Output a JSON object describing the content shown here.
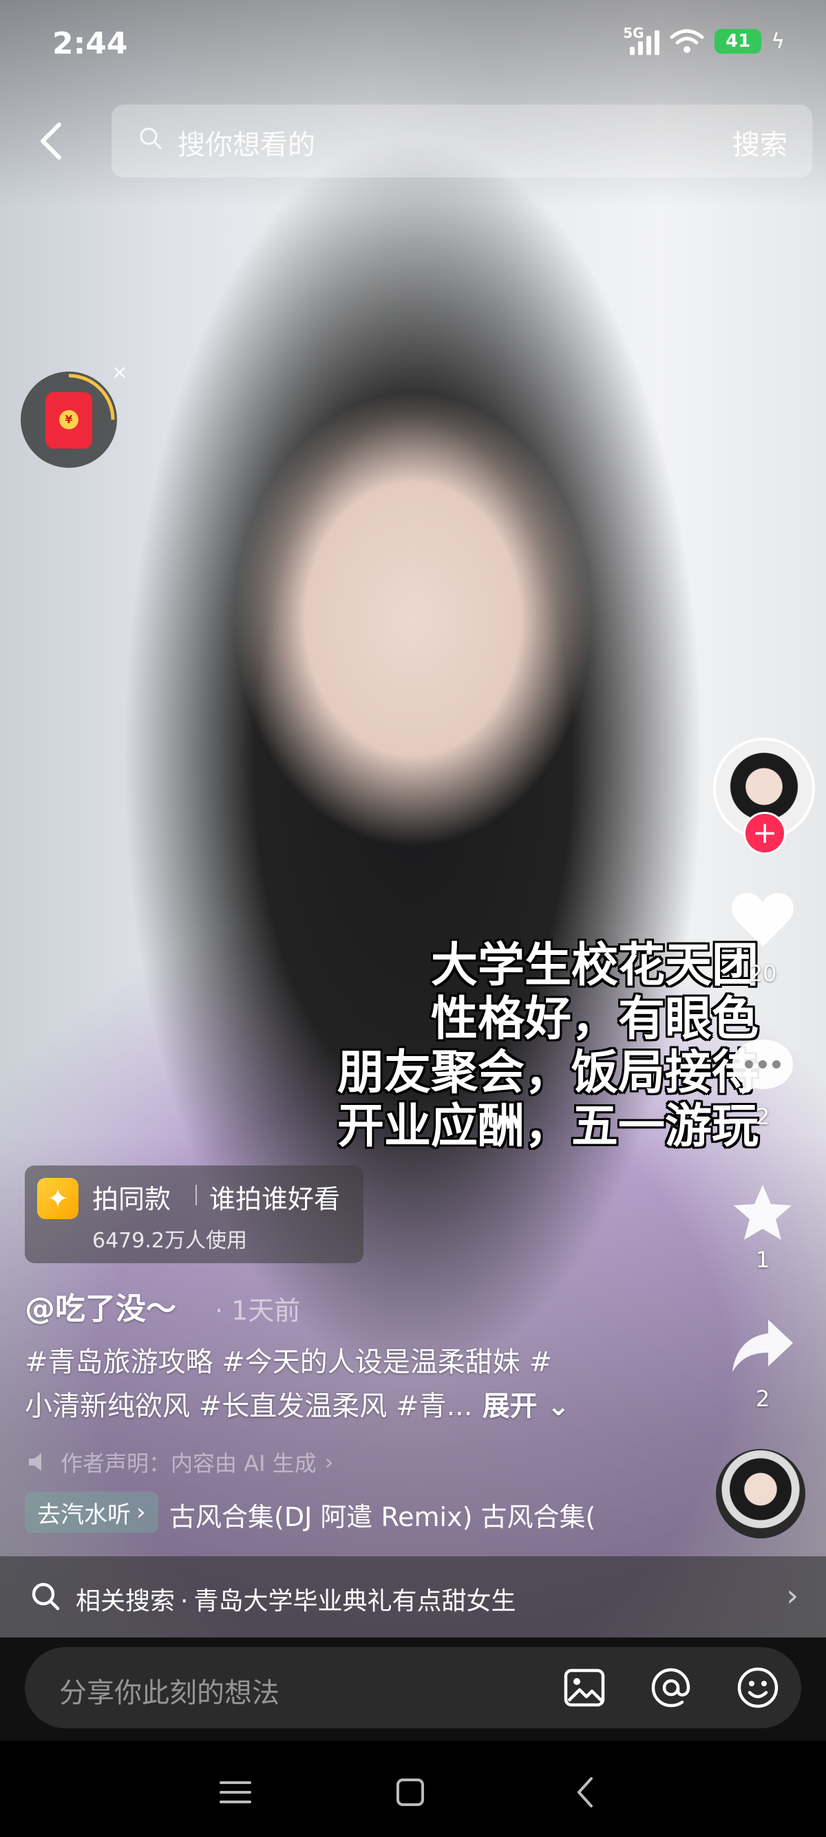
{
  "status_bar": {
    "time": "2:44",
    "network": "5G",
    "battery": "41"
  },
  "search": {
    "placeholder": "搜你想看的",
    "button": "搜索"
  },
  "overlay_text": [
    "大学生校花天团",
    "性格好，有眼色",
    "朋友聚会，饭局接待",
    "开业应酬，五一游玩"
  ],
  "effect": {
    "name": "拍同款",
    "desc": "谁拍谁好看",
    "usage": "6479.2万人使用"
  },
  "post": {
    "author": "@吃了没～",
    "time": "· 1天前",
    "caption_line1": "#青岛旅游攻略 #今天的人设是温柔甜妹 #",
    "caption_line2": "小清新纯欲风 #长直发温柔风 #青...",
    "expand": "展开",
    "ai_note": "作者声明：内容由 AI 生成"
  },
  "music": {
    "chip": "去汽水听",
    "title": "古风合集(DJ 阿遣 Remix)    古风合集("
  },
  "rail": {
    "likes": "20",
    "comments": "2",
    "favorites": "1",
    "shares": "2"
  },
  "related": {
    "prefix": "相关搜索",
    "dot": "·",
    "query": "青岛大学毕业典礼有点甜女生"
  },
  "comment": {
    "placeholder": "分享你此刻的想法"
  },
  "colors": {
    "follow": "#fe2c55",
    "battery": "#35c759",
    "effect": "#ffb300"
  }
}
